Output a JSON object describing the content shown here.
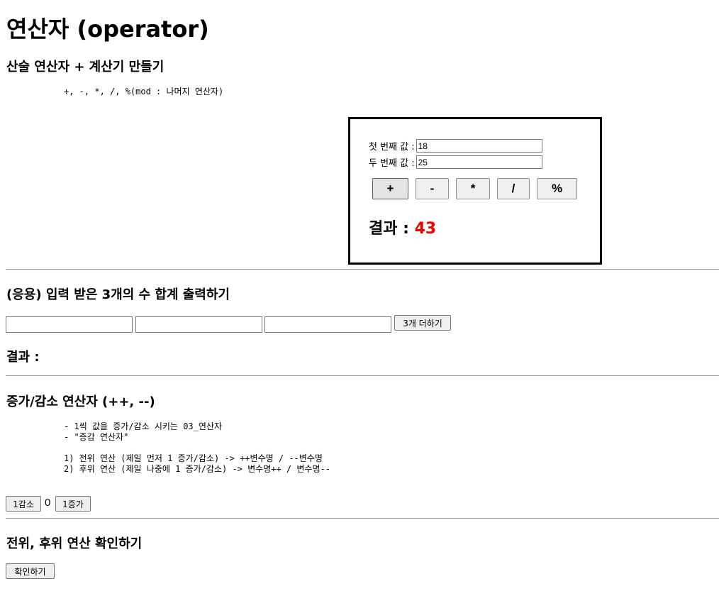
{
  "page": {
    "title": "연산자 (operator)"
  },
  "arith": {
    "heading": "산술 연산자 + 계산기 만들기",
    "pre": "+, -, *, /, %(mod : 나머지 연산자)"
  },
  "calculator": {
    "first_label": "첫 번째 값 :",
    "first_value": "18",
    "second_label": "두 번째 값 :",
    "second_value": "25",
    "ops": [
      "+",
      "-",
      "*",
      "/",
      "%"
    ],
    "result_label": "결과 :",
    "result_value": "43"
  },
  "sum3": {
    "heading": "(응용) 입력 받은 3개의 수 합계 출력하기",
    "button_label": "3개 더하기",
    "result_label": "결과 :"
  },
  "incdec": {
    "heading": "증가/감소 연산자 (++, --)",
    "pre": "- 1씩 값을 증가/감소 시키는 03_연산자\n- \"증감 연산자\"\n\n1) 전위 연산 (제일 먼저 1 증가/감소) -> ++변수명 / --변수명\n2) 후위 연산 (제일 나중에 1 증가/감소) -> 변수명++ / 변수명--",
    "dec_label": "1감소",
    "count": "0",
    "inc_label": "1증가"
  },
  "prepost": {
    "heading": "전위, 후위 연산 확인하기",
    "button_label": "확인하기"
  }
}
